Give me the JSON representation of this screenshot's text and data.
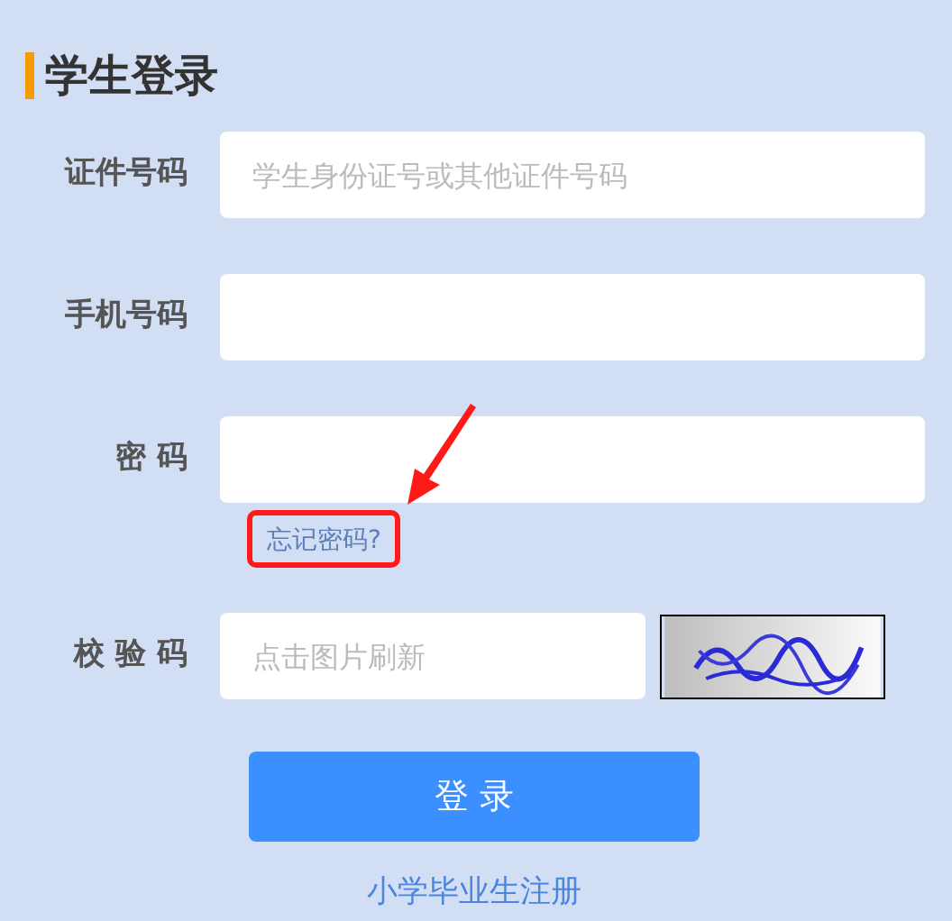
{
  "title": "学生登录",
  "fields": [
    {
      "label": "证件号码",
      "placeholder": "学生身份证号或其他证件号码"
    },
    {
      "label": "手机号码"
    },
    {
      "label": "密 码"
    }
  ],
  "forgot_link": "忘记密码?",
  "captcha": {
    "label": "校 验 码",
    "placeholder": "点击图片刷新"
  },
  "login_button": "登 录",
  "register_link": "小学毕业生注册"
}
